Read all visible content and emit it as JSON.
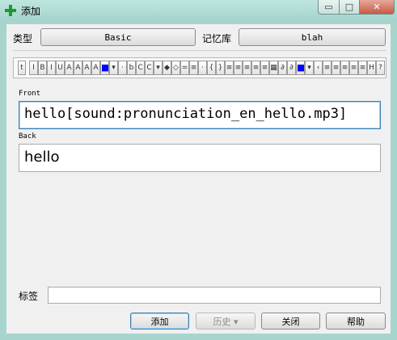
{
  "window": {
    "title": "添加",
    "min_glyph": "▭",
    "max_glyph": "□",
    "close_glyph": "✕"
  },
  "top": {
    "type_label": "类型",
    "type_value": "Basic",
    "deck_label": "记忆库",
    "deck_value": "blah"
  },
  "toolbar": {
    "buttons": [
      "t",
      "I",
      "B",
      "I",
      "U",
      "A",
      "A",
      "A",
      "A",
      "■",
      "▾",
      "·",
      "b",
      "C",
      "C",
      "▾",
      "◆",
      "◇",
      "=",
      "≡",
      "·",
      "{",
      "}",
      "≡",
      "≡",
      "≡",
      "≡",
      "≡",
      "▦",
      "∂",
      "∂",
      "■",
      "▾",
      "‹",
      "≡",
      "≡",
      "≡",
      "≡",
      "≡",
      "H",
      "?"
    ]
  },
  "fields": [
    {
      "label": "Front",
      "value": "hello[sound:pronunciation_en_hello.mp3]"
    },
    {
      "label": "Back",
      "value": "hello"
    }
  ],
  "tags": {
    "label": "标签",
    "value": ""
  },
  "buttons": {
    "add": "添加",
    "history": "历史 ▾",
    "close": "关闭",
    "help": "帮助"
  },
  "colors": {
    "accent": "#3c7fb1",
    "titlebar": "#a8d4ce",
    "color_swatch": "#0000ff"
  }
}
